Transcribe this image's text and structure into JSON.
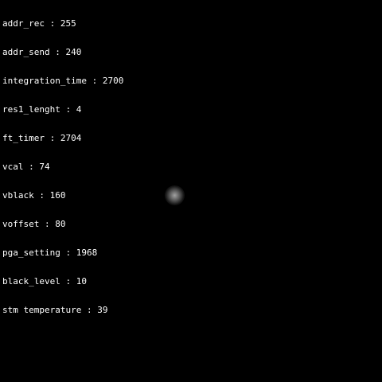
{
  "overlay": {
    "lines": [
      {
        "key": "addr_rec",
        "value": "255"
      },
      {
        "key": "addr_send",
        "value": "240"
      },
      {
        "key": "integration_time",
        "value": "2700"
      },
      {
        "key": "res1_lenght",
        "value": "4"
      },
      {
        "key": "ft_timer",
        "value": "2704"
      },
      {
        "key": "vcal",
        "value": "74"
      },
      {
        "key": "vblack",
        "value": "160"
      },
      {
        "key": "voffset",
        "value": "80"
      },
      {
        "key": "pga_setting",
        "value": "1968"
      },
      {
        "key": "black_level",
        "value": "10"
      },
      {
        "key": "stm temperature",
        "value": "39"
      }
    ],
    "separator": " : "
  },
  "colors": {
    "background": "#000000",
    "text": "#ffffff",
    "blob": "#bebebe"
  }
}
